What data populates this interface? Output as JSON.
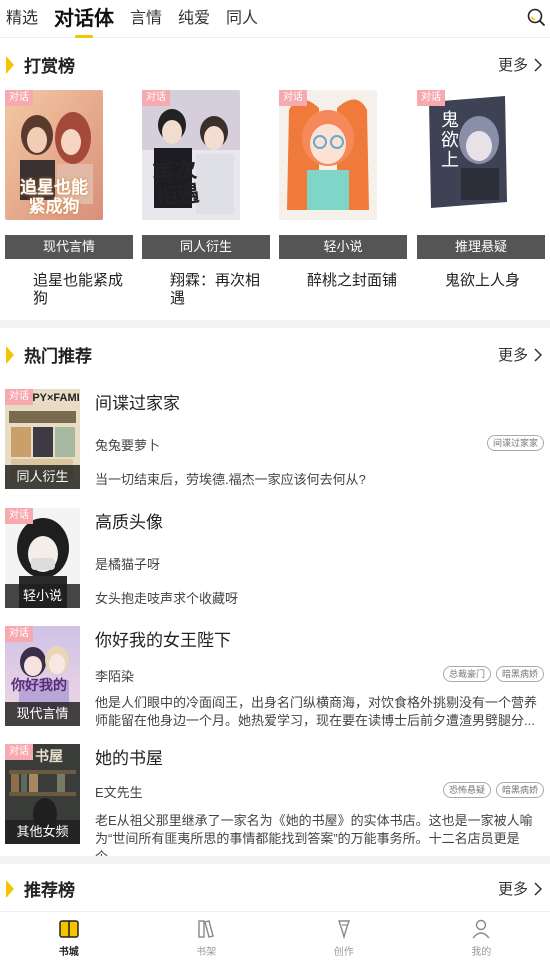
{
  "top_tabs": [
    "精选",
    "对话体",
    "言情",
    "纯爱",
    "同人"
  ],
  "active_tab_index": 1,
  "sections": {
    "reward": {
      "title": "打赏榜",
      "more": "更多"
    },
    "hot": {
      "title": "热门推荐",
      "more": "更多"
    },
    "recommend": {
      "title": "推荐榜",
      "more": "更多"
    }
  },
  "badge_label": "对话",
  "reward_books": [
    {
      "genre": "现代言情",
      "name": "追星也能紧成狗",
      "cover_text": "追星也能\n紧成狗"
    },
    {
      "genre": "同人衍生",
      "name": "翔霖：再次相遇",
      "cover_text": "再次\n相遇"
    },
    {
      "genre": "轻小说",
      "name": "醉桃之封面铺",
      "cover_text": ""
    },
    {
      "genre": "推理悬疑",
      "name": "鬼欲上人身",
      "cover_text": "鬼欲上"
    }
  ],
  "hot_books": [
    {
      "title": "间谍过家家",
      "author": "兔兔要萝卜",
      "tags": [
        "间谍过家家"
      ],
      "label": "同人衍生",
      "desc": "当一切结束后，劳埃德.福杰一家应该何去何从?",
      "cover_text": "SPY×FAMILY"
    },
    {
      "title": "高质头像",
      "author": "是橘猫子呀",
      "tags": [],
      "label": "轻小说",
      "desc": "女头抱走吱声求个收藏呀",
      "cover_text": ""
    },
    {
      "title": "你好我的女王陛下",
      "author": "李陌染",
      "tags": [
        "总裁豪门",
        "暗黑病娇"
      ],
      "label": "现代言情",
      "desc": "他是人们眼中的冷面阎王，出身名门纵横商海，对饮食格外挑剔没有一个营养师能留在他身边一个月。她热爱学习，现在要在读博士后前夕遭渣男劈腿分...",
      "cover_text": "你好我的"
    },
    {
      "title": "她的书屋",
      "author": "E文先生",
      "tags": [
        "恐怖悬疑",
        "暗黑病娇"
      ],
      "label": "其他女频",
      "desc": "老E从祖父那里继承了一家名为《她的书屋》的实体书店。这也是一家被人喻为“世间所有匪夷所思的事情都能找到答案”的万能事务所。十二名店员更是个...",
      "cover_text": "书屋"
    }
  ],
  "bottom_nav": [
    {
      "label": "书城",
      "icon": "book-city-icon"
    },
    {
      "label": "书架",
      "icon": "bookshelf-icon"
    },
    {
      "label": "创作",
      "icon": "create-icon"
    },
    {
      "label": "我的",
      "icon": "profile-icon"
    }
  ],
  "active_nav_index": 0,
  "colors": {
    "accent": "#f5c400",
    "badge": "#f7a9b0",
    "genre_bar": "#555555"
  }
}
